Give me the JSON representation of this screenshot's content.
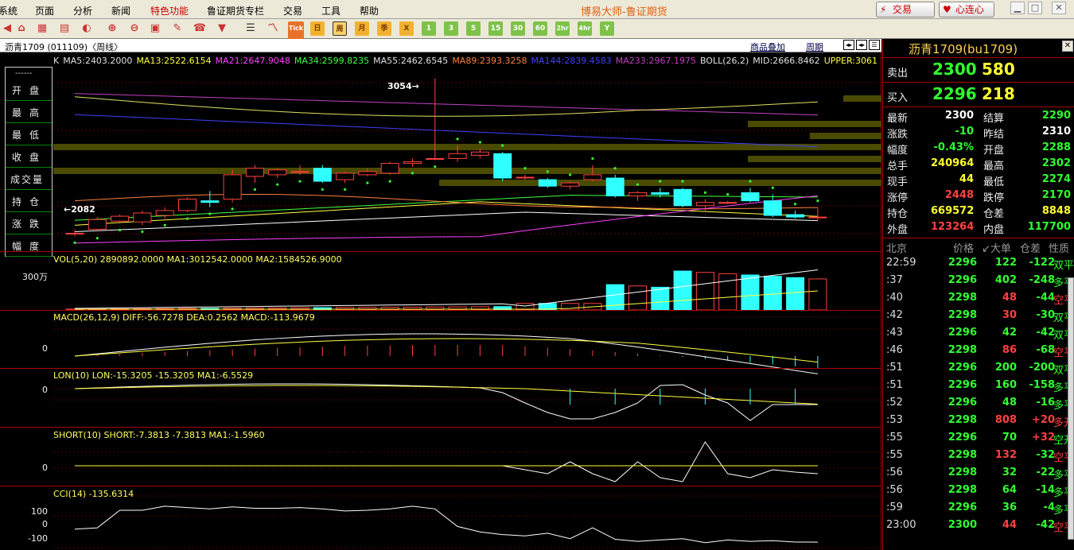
{
  "menu": {
    "items": [
      "系统",
      "页面",
      "分析",
      "新闻",
      "特色功能",
      "鲁证期货专栏",
      "交易",
      "工具",
      "帮助"
    ],
    "special_index": 4,
    "app_title": "博易大师-鲁证期货",
    "trade_button": "交易",
    "connect_button": "心连心"
  },
  "toolbar": {
    "labels": [
      "Tick",
      "日",
      "周",
      "月",
      "季",
      "X",
      "1",
      "3",
      "5",
      "15",
      "30",
      "60",
      "2hr",
      "4hr",
      "Y"
    ],
    "selected": "周"
  },
  "chart": {
    "header_title": "沥青1709 (011109)〈周线〉",
    "overlay_link": "商品叠加",
    "period_link": "周期",
    "ma_legend": [
      {
        "text": "K",
        "color": "#e0e0e0"
      },
      {
        "text": "MA5:2403.2000",
        "color": "#e0e0e0"
      },
      {
        "text": "MA13:2522.6154",
        "color": "#ffff40"
      },
      {
        "text": "MA21:2647.9048",
        "color": "#ff40ff"
      },
      {
        "text": "MA34:2599.8235",
        "color": "#40ff40"
      },
      {
        "text": "MA55:2462.6545",
        "color": "#e0e0e0"
      },
      {
        "text": "MA89:2393.3258",
        "color": "#ff8040"
      },
      {
        "text": "MA144:2839.4583",
        "color": "#4040ff"
      },
      {
        "text": "MA233:2967.1975",
        "color": "#c040c0"
      },
      {
        "text": "BOLL(26,2)",
        "color": "#e0e0e0"
      },
      {
        "text": "MID:2666.8462",
        "color": "#e0e0e0"
      },
      {
        "text": "UPPER:3061",
        "color": "#ffff40"
      }
    ],
    "high_mark": "3054",
    "low_mark": "2082",
    "left_panel": [
      "开盘",
      "最高",
      "最低",
      "收盘",
      "成交量",
      "持仓",
      "涨跌",
      "幅度"
    ],
    "left_panel_header": "------",
    "vol_title": "VOL(5,20) 2890892.0000 MA1:3012542.0000 MA2:1584526.9000",
    "vol_ylabel": "300万",
    "macd_title": "MACD(26,12,9) DIFF:-56.7278 DEA:0.2562 MACD:-113.9679",
    "macd_ylabel": "0",
    "lon_title": "LON(10) LON:-15.3205 -15.3205 MA1:-6.5529",
    "lon_ylabel": "0",
    "short_title": "SHORT(10) SHORT:-7.3813 -7.3813 MA1:-1.5960",
    "short_ylabel": "0",
    "cci_title": "CCI(14) -135.6314",
    "cci_ylabels": [
      "100",
      "0",
      "-100"
    ]
  },
  "quote": {
    "title": "沥青1709(bu1709)",
    "ask_label": "卖出",
    "ask_price": "2300",
    "ask_vol": "580",
    "bid_label": "买入",
    "bid_price": "2296",
    "bid_vol": "218",
    "rows": [
      {
        "a": "最新",
        "b": "2300",
        "bc": "#ffffff",
        "c": "结算",
        "d": "2290",
        "dc": "#30ff30"
      },
      {
        "a": "涨跌",
        "b": "-10",
        "bc": "#30ff30",
        "c": "昨结",
        "d": "2310",
        "dc": "#ffffff"
      },
      {
        "a": "幅度",
        "b": "-0.43%",
        "bc": "#30ff30",
        "c": "开盘",
        "d": "2288",
        "dc": "#30ff30"
      },
      {
        "a": "总手",
        "b": "240964",
        "bc": "#ffff30",
        "c": "最高",
        "d": "2302",
        "dc": "#30ff30"
      },
      {
        "a": "现手",
        "b": "44",
        "bc": "#ffff30",
        "c": "最低",
        "d": "2274",
        "dc": "#30ff30"
      },
      {
        "a": "涨停",
        "b": "2448",
        "bc": "#ff4040",
        "c": "跌停",
        "d": "2170",
        "dc": "#30ff30"
      },
      {
        "a": "持仓",
        "b": "669572",
        "bc": "#ffff30",
        "c": "仓差",
        "d": "8848",
        "dc": "#ffff30"
      },
      {
        "a": "外盘",
        "b": "123264",
        "bc": "#ff4040",
        "c": "内盘",
        "d": "117700",
        "dc": "#30ff30"
      }
    ],
    "tick_header": [
      "北京",
      "价格",
      "↙大单",
      "仓差",
      "性质"
    ],
    "ticks": [
      {
        "t": "22:59",
        "p": "2296",
        "v": "122",
        "vc": "#30ff30",
        "o": "-122",
        "oc": "#30ff30",
        "y": "双平",
        "yc": "#30ff30"
      },
      {
        "t": ":37",
        "p": "2296",
        "v": "402",
        "vc": "#30ff30",
        "o": "-248",
        "oc": "#30ff30",
        "y": "多平",
        "yc": "#30ff30"
      },
      {
        "t": ":40",
        "p": "2298",
        "v": "48",
        "vc": "#ff4040",
        "o": "-44",
        "oc": "#30ff30",
        "y": "空平",
        "yc": "#ff4040"
      },
      {
        "t": ":42",
        "p": "2298",
        "v": "30",
        "vc": "#ff4040",
        "o": "-30",
        "oc": "#30ff30",
        "y": "双平",
        "yc": "#30ff30"
      },
      {
        "t": ":43",
        "p": "2296",
        "v": "42",
        "vc": "#30ff30",
        "o": "-42",
        "oc": "#30ff30",
        "y": "双平",
        "yc": "#30ff30"
      },
      {
        "t": ":46",
        "p": "2298",
        "v": "86",
        "vc": "#ff4040",
        "o": "-68",
        "oc": "#30ff30",
        "y": "空平",
        "yc": "#ff4040"
      },
      {
        "t": ":51",
        "p": "2296",
        "v": "200",
        "vc": "#30ff30",
        "o": "-200",
        "oc": "#30ff30",
        "y": "双平",
        "yc": "#30ff30"
      },
      {
        "t": ":51",
        "p": "2296",
        "v": "160",
        "vc": "#30ff30",
        "o": "-158",
        "oc": "#30ff30",
        "y": "多平",
        "yc": "#30ff30"
      },
      {
        "t": ":52",
        "p": "2296",
        "v": "48",
        "vc": "#30ff30",
        "o": "-16",
        "oc": "#30ff30",
        "y": "多平",
        "yc": "#30ff30"
      },
      {
        "t": ":53",
        "p": "2298",
        "v": "808",
        "vc": "#ff4040",
        "o": "+20",
        "oc": "#ff4040",
        "y": "多开",
        "yc": "#ff4040"
      },
      {
        "t": ":55",
        "p": "2296",
        "v": "70",
        "vc": "#30ff30",
        "o": "+32",
        "oc": "#ff4040",
        "y": "空开",
        "yc": "#30ff30"
      },
      {
        "t": ":55",
        "p": "2298",
        "v": "132",
        "vc": "#ff4040",
        "o": "-32",
        "oc": "#30ff30",
        "y": "空平",
        "yc": "#ff4040"
      },
      {
        "t": ":56",
        "p": "2298",
        "v": "32",
        "vc": "#30ff30",
        "o": "-22",
        "oc": "#30ff30",
        "y": "多平",
        "yc": "#30ff30"
      },
      {
        "t": ":56",
        "p": "2298",
        "v": "64",
        "vc": "#30ff30",
        "o": "-14",
        "oc": "#30ff30",
        "y": "多平",
        "yc": "#30ff30"
      },
      {
        "t": ":59",
        "p": "2296",
        "v": "36",
        "vc": "#30ff30",
        "o": "-4",
        "oc": "#30ff30",
        "y": "多平",
        "yc": "#30ff30"
      },
      {
        "t": "23:00",
        "p": "2300",
        "v": "44",
        "vc": "#ff4040",
        "o": "-42",
        "oc": "#30ff30",
        "y": "空平",
        "yc": "#ff4040"
      }
    ]
  },
  "chart_data": {
    "type": "candlestick",
    "instrument": "沥青1709",
    "period": "周线",
    "candles": [
      {
        "o": 2100,
        "h": 2125,
        "l": 2082,
        "c": 2100
      },
      {
        "o": 2125,
        "h": 2200,
        "l": 2110,
        "c": 2185
      },
      {
        "o": 2175,
        "h": 2215,
        "l": 2160,
        "c": 2205
      },
      {
        "o": 2170,
        "h": 2240,
        "l": 2150,
        "c": 2225
      },
      {
        "o": 2210,
        "h": 2260,
        "l": 2190,
        "c": 2240
      },
      {
        "o": 2240,
        "h": 2320,
        "l": 2230,
        "c": 2310
      },
      {
        "o": 2300,
        "h": 2360,
        "l": 2260,
        "c": 2290
      },
      {
        "o": 2310,
        "h": 2490,
        "l": 2290,
        "c": 2460
      },
      {
        "o": 2450,
        "h": 2520,
        "l": 2410,
        "c": 2500
      },
      {
        "o": 2460,
        "h": 2500,
        "l": 2440,
        "c": 2490
      },
      {
        "o": 2480,
        "h": 2520,
        "l": 2460,
        "c": 2480
      },
      {
        "o": 2500,
        "h": 2520,
        "l": 2410,
        "c": 2420
      },
      {
        "o": 2430,
        "h": 2480,
        "l": 2410,
        "c": 2470
      },
      {
        "o": 2460,
        "h": 2500,
        "l": 2450,
        "c": 2480
      },
      {
        "o": 2470,
        "h": 2540,
        "l": 2460,
        "c": 2530
      },
      {
        "o": 2530,
        "h": 2560,
        "l": 2510,
        "c": 2540
      },
      {
        "o": 2560,
        "h": 3054,
        "l": 2550,
        "c": 2560
      },
      {
        "o": 2560,
        "h": 2640,
        "l": 2540,
        "c": 2590
      },
      {
        "o": 2580,
        "h": 2620,
        "l": 2560,
        "c": 2600
      },
      {
        "o": 2590,
        "h": 2600,
        "l": 2420,
        "c": 2440
      },
      {
        "o": 2440,
        "h": 2460,
        "l": 2430,
        "c": 2445
      },
      {
        "o": 2430,
        "h": 2440,
        "l": 2380,
        "c": 2390
      },
      {
        "o": 2390,
        "h": 2420,
        "l": 2370,
        "c": 2410
      },
      {
        "o": 2430,
        "h": 2520,
        "l": 2420,
        "c": 2460
      },
      {
        "o": 2440,
        "h": 2460,
        "l": 2320,
        "c": 2330
      },
      {
        "o": 2330,
        "h": 2360,
        "l": 2300,
        "c": 2350
      },
      {
        "o": 2350,
        "h": 2380,
        "l": 2320,
        "c": 2340
      },
      {
        "o": 2370,
        "h": 2380,
        "l": 2260,
        "c": 2270
      },
      {
        "o": 2270,
        "h": 2310,
        "l": 2240,
        "c": 2290
      },
      {
        "o": 2290,
        "h": 2300,
        "l": 2280,
        "c": 2290
      },
      {
        "o": 2350,
        "h": 2380,
        "l": 2290,
        "c": 2300
      },
      {
        "o": 2300,
        "h": 2340,
        "l": 2200,
        "c": 2210
      },
      {
        "o": 2215,
        "h": 2240,
        "l": 2190,
        "c": 2200
      },
      {
        "o": 2200,
        "h": 2260,
        "l": 2180,
        "c": 2200
      }
    ],
    "ylim": [
      2000,
      3100
    ]
  }
}
